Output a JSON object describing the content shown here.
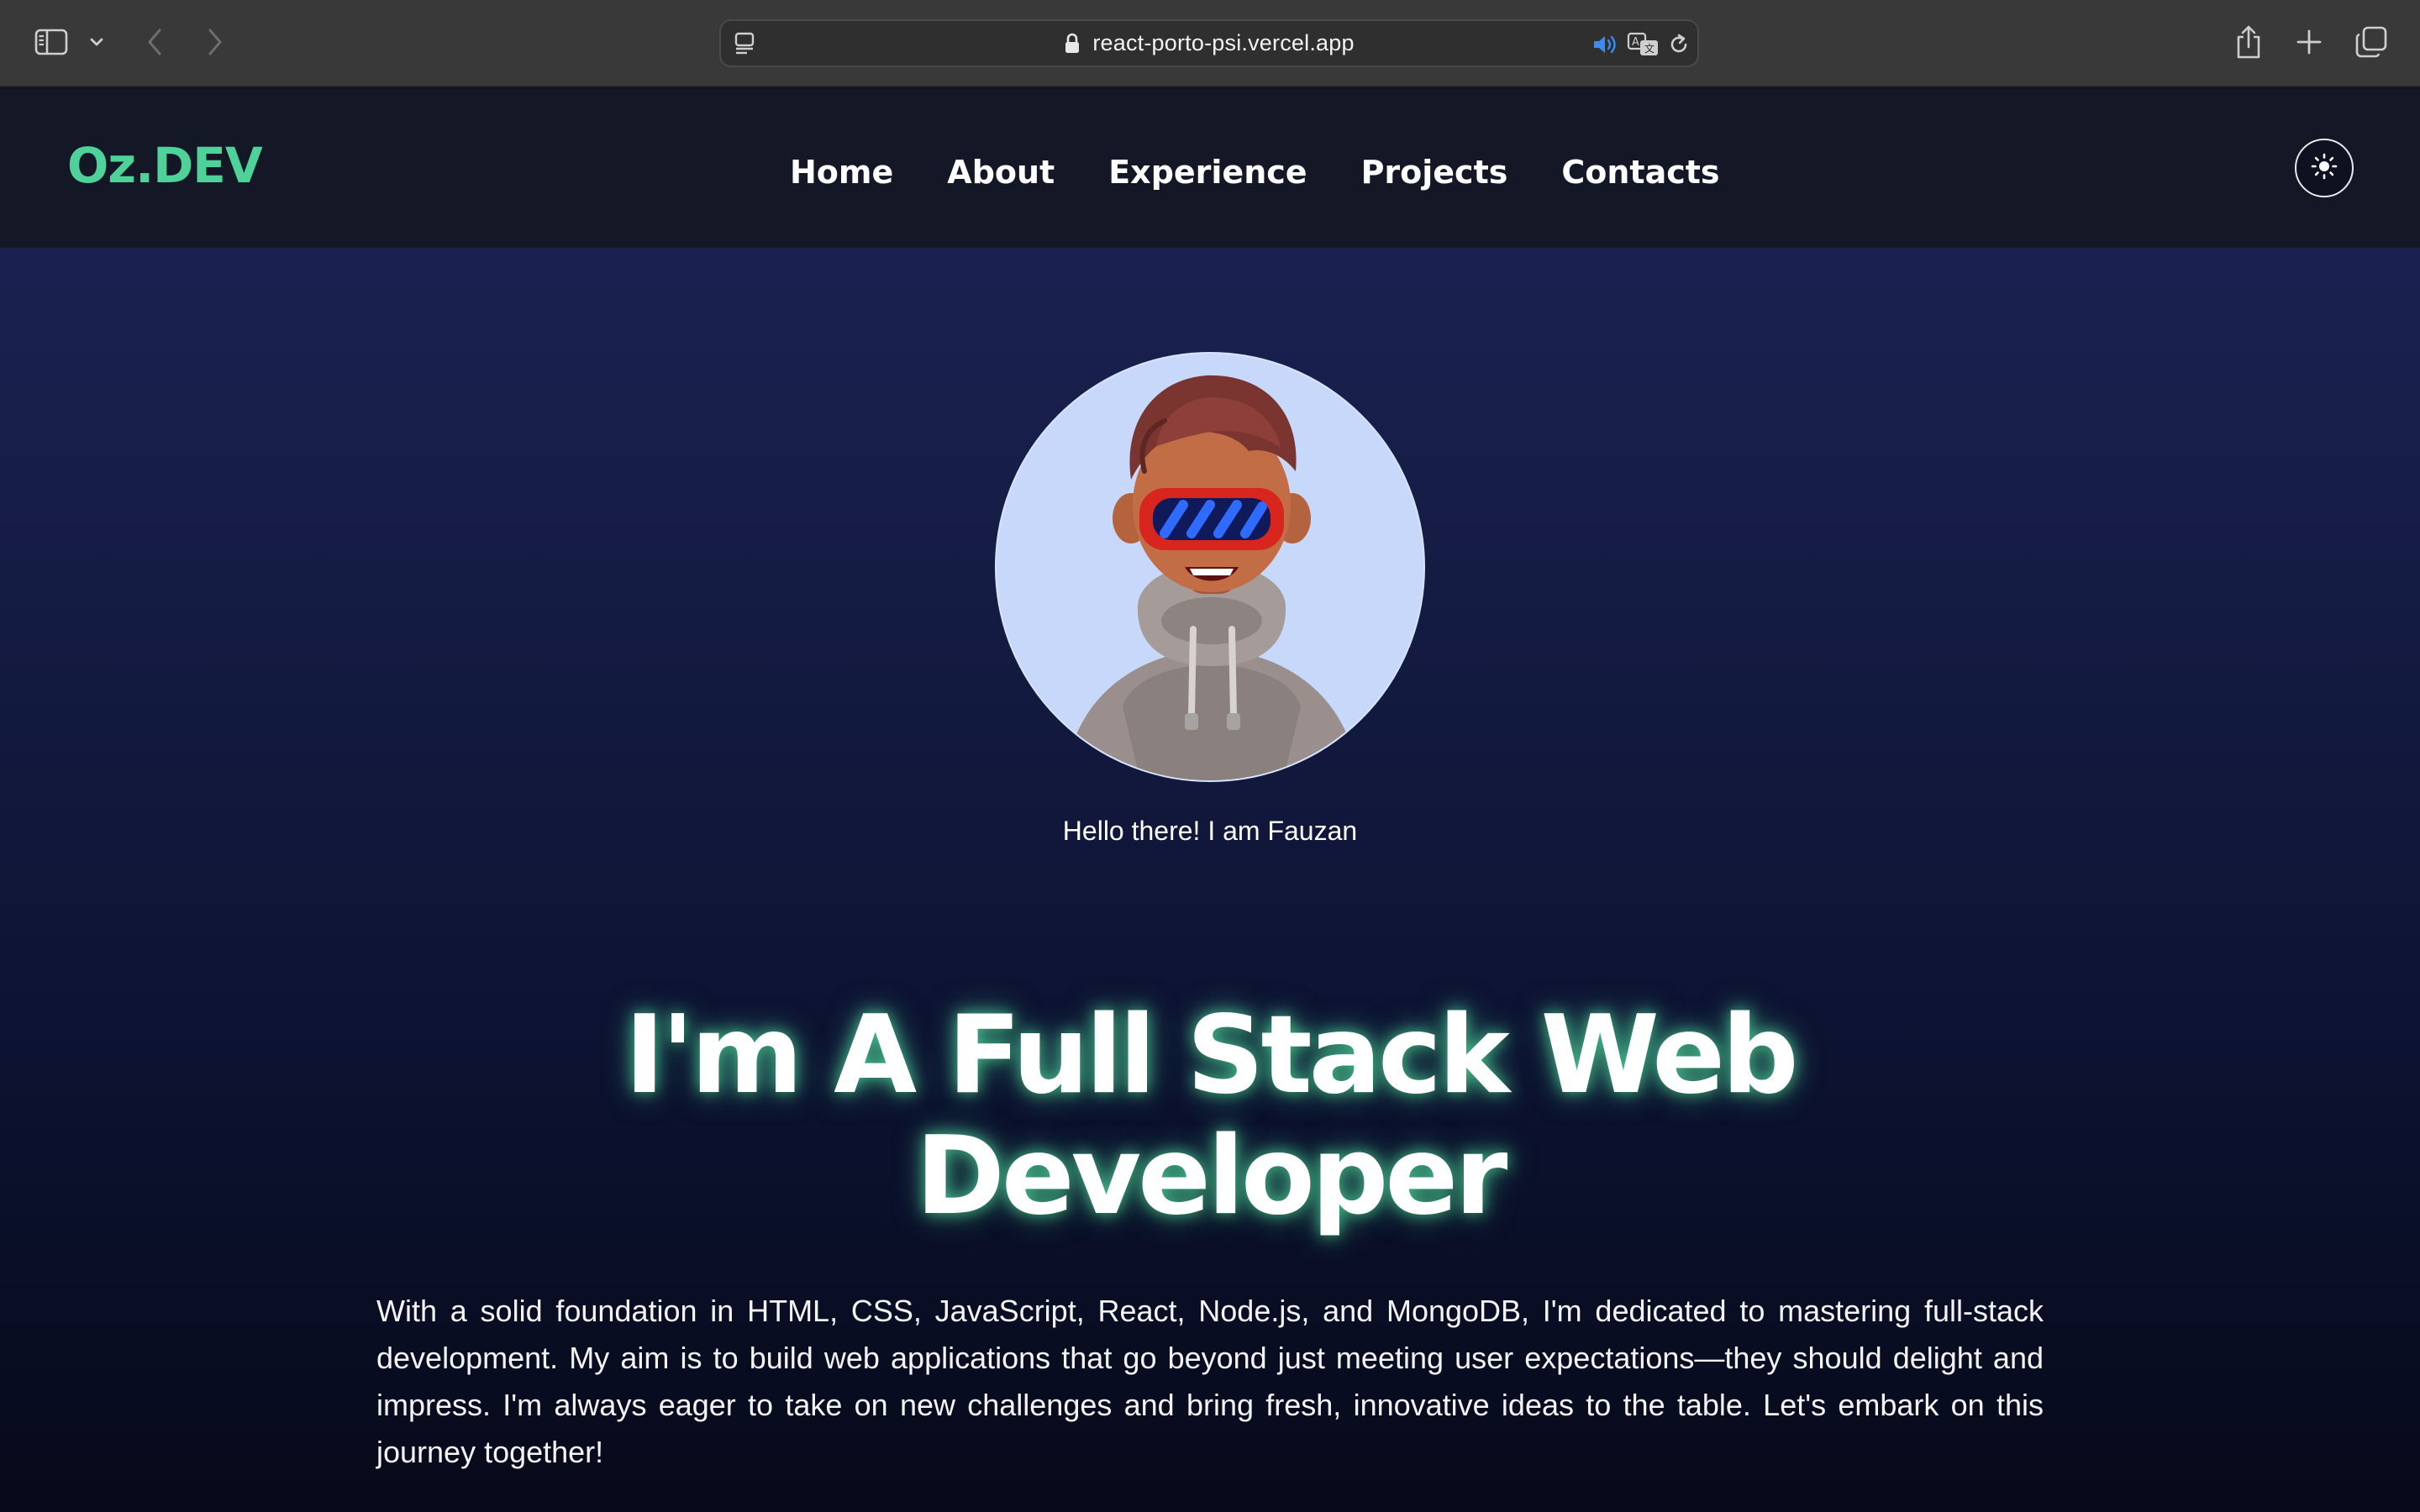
{
  "browser": {
    "url": "react-porto-psi.vercel.app",
    "icons": {
      "sidebar": "sidebar-icon",
      "back": "chevron-left-icon",
      "forward": "chevron-right-icon",
      "reader": "reader-icon",
      "lock": "lock-icon",
      "audio": "speaker-icon",
      "translate": "translate-icon",
      "reload": "reload-icon",
      "share": "share-icon",
      "new_tab": "plus-icon",
      "tab_overview": "tabs-icon"
    }
  },
  "site": {
    "brand": "Oz.DEV",
    "nav": [
      {
        "label": "Home"
      },
      {
        "label": "About"
      },
      {
        "label": "Experience"
      },
      {
        "label": "Projects"
      },
      {
        "label": "Contacts"
      }
    ],
    "theme_toggle_icon": "sun-icon"
  },
  "hero": {
    "avatar_alt": "avatar-illustration",
    "greeting": "Hello there! I am Fauzan",
    "headline_line1": "I'm A Full Stack Web",
    "headline_line2": "Developer",
    "intro": "With a solid foundation in HTML, CSS, JavaScript, React, Node.js, and MongoDB, I'm dedicated to mastering full-stack development. My aim is to build web applications that go beyond just meeting user expectations—they should delight and impress. I'm always eager to take on new challenges and bring fresh, innovative ideas to the table. Let's embark on this journey together!"
  },
  "colors": {
    "brand_accent": "#4fd29a",
    "nav_background": "#141826",
    "hero_top": "#1a2150",
    "hero_bottom": "#070a1a",
    "avatar_background": "#c7d8fa"
  }
}
